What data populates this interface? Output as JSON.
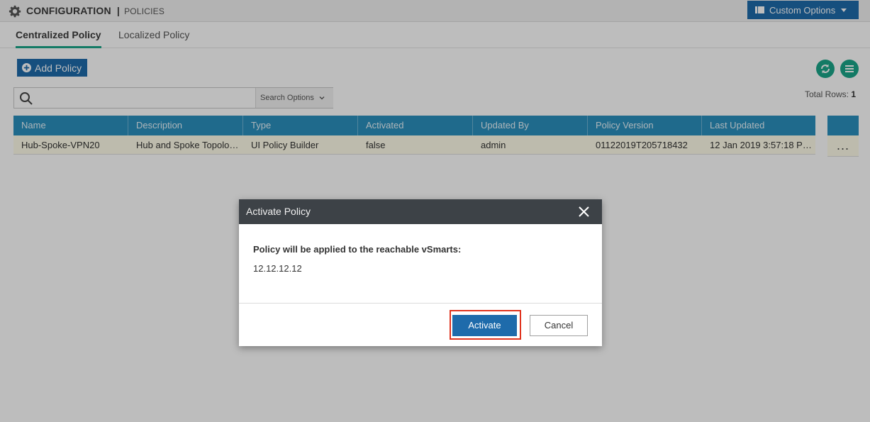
{
  "header": {
    "title": "CONFIGURATION",
    "separator": "|",
    "subtitle": "POLICIES",
    "custom_options_label": "Custom Options"
  },
  "tabs": [
    {
      "label": "Centralized Policy",
      "active": true
    },
    {
      "label": "Localized Policy",
      "active": false
    }
  ],
  "toolbar": {
    "add_policy_label": "Add Policy",
    "search_placeholder": "",
    "search_options_label": "Search Options",
    "total_rows_label": "Total Rows:",
    "total_rows_value": "1"
  },
  "table": {
    "columns": [
      "Name",
      "Description",
      "Type",
      "Activated",
      "Updated By",
      "Policy Version",
      "Last Updated"
    ],
    "rows": [
      [
        "Hub-Spoke-VPN20",
        "Hub and Spoke Topology...",
        "UI Policy Builder",
        "false",
        "admin",
        "01122019T205718432",
        "12 Jan 2019 3:57:18 PM ..."
      ]
    ],
    "row_actions_label": "..."
  },
  "modal": {
    "title": "Activate Policy",
    "message": "Policy will be applied to the reachable vSmarts:",
    "ip": "12.12.12.12",
    "activate_label": "Activate",
    "cancel_label": "Cancel"
  },
  "colors": {
    "primary": "#1e6bab",
    "accent_teal": "#1aa589",
    "table_header": "#2b8fbd",
    "highlight": "#e0331e"
  },
  "icons": [
    "gear-icon",
    "list-icon",
    "plus-circle-icon",
    "refresh-icon",
    "menu-icon",
    "search-icon",
    "chevron-down-icon",
    "close-icon"
  ]
}
